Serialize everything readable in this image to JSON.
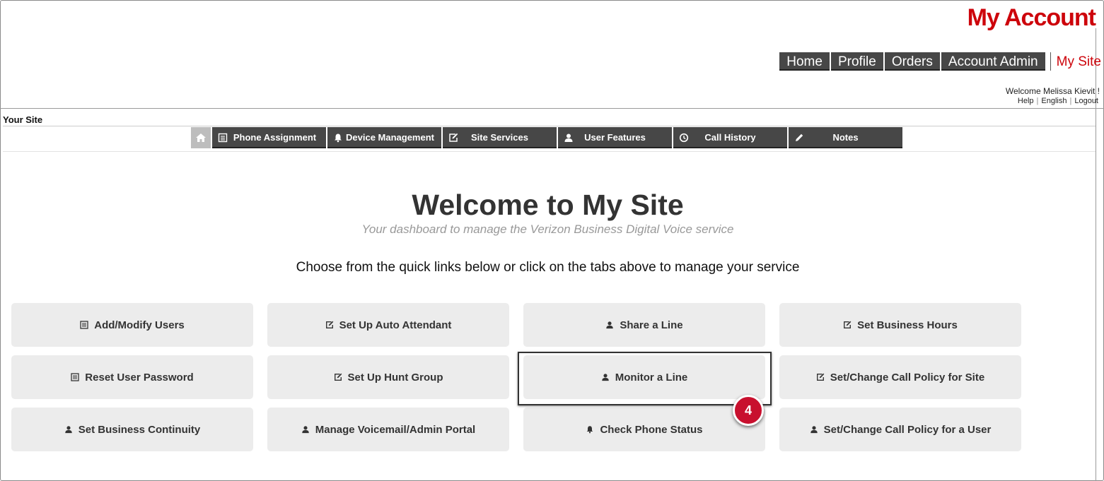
{
  "brand": {
    "title": "My Account",
    "accent": "#cd040b"
  },
  "top_nav": {
    "tabs": [
      {
        "label": "Home"
      },
      {
        "label": "Profile"
      },
      {
        "label": "Orders"
      },
      {
        "label": "Account Admin"
      }
    ],
    "active": "My Site"
  },
  "user": {
    "welcome": "Welcome Melissa Kievit !",
    "links": {
      "help": "Help",
      "language": "English",
      "logout": "Logout"
    }
  },
  "section_label": "Your Site",
  "sub_nav": {
    "home_icon": "home-icon",
    "tabs": [
      {
        "label": "Phone Assignment",
        "icon": "list-icon"
      },
      {
        "label": "Device Management",
        "icon": "bell-icon"
      },
      {
        "label": "Site Services",
        "icon": "edit-icon"
      },
      {
        "label": "User Features",
        "icon": "user-icon"
      },
      {
        "label": "Call History",
        "icon": "clock-icon"
      },
      {
        "label": "Notes",
        "icon": "pencil-icon"
      }
    ]
  },
  "hero": {
    "title": "Welcome to My Site",
    "subtitle": "Your dashboard to manage the Verizon Business Digital Voice service",
    "instruction": "Choose from the quick links below or click on the tabs above to manage your service"
  },
  "quick_links": [
    {
      "label": "Add/Modify Users",
      "icon": "list-icon"
    },
    {
      "label": "Set Up Auto Attendant",
      "icon": "edit-icon"
    },
    {
      "label": "Share a Line",
      "icon": "user-icon"
    },
    {
      "label": "Set Business Hours",
      "icon": "edit-icon"
    },
    {
      "label": "Reset User Password",
      "icon": "list-icon"
    },
    {
      "label": "Set Up Hunt Group",
      "icon": "edit-icon"
    },
    {
      "label": "Monitor a Line",
      "icon": "user-icon"
    },
    {
      "label": "Set/Change Call Policy for Site",
      "icon": "edit-icon"
    },
    {
      "label": "Set Business Continuity",
      "icon": "user-icon"
    },
    {
      "label": "Manage Voicemail/Admin Portal",
      "icon": "user-icon"
    },
    {
      "label": "Check Phone Status",
      "icon": "bell-icon"
    },
    {
      "label": "Set/Change Call Policy for a User",
      "icon": "user-icon"
    }
  ],
  "callout": {
    "step": "4",
    "color": "#c8102e"
  }
}
